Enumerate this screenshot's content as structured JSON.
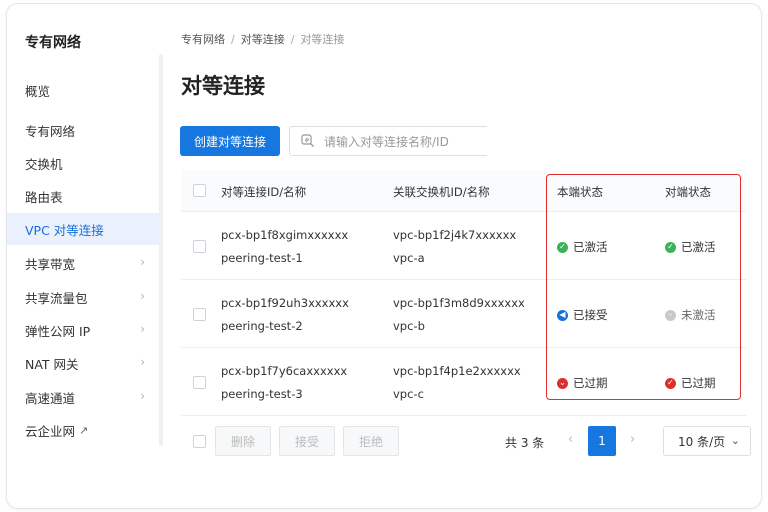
{
  "sidebar": {
    "title": "专有网络",
    "items": [
      {
        "label": "概览"
      },
      {
        "label": "专有网络"
      },
      {
        "label": "交换机"
      },
      {
        "label": "路由表"
      },
      {
        "label": "VPC 对等连接"
      },
      {
        "label": "共享带宽"
      },
      {
        "label": "共享流量包"
      },
      {
        "label": "弹性公网 IP"
      },
      {
        "label": "NAT 网关"
      },
      {
        "label": "高速通道"
      },
      {
        "label": "云企业网"
      }
    ]
  },
  "breadcrumb": [
    "专有网络",
    "对等连接",
    "对等连接"
  ],
  "page_title": "对等连接",
  "toolbar": {
    "create_label": "创建对等连接",
    "search_placeholder": "请输入对等连接名称/ID"
  },
  "table": {
    "headers": {
      "name": "对等连接ID/名称",
      "peer": "关联交换机ID/名称",
      "local_status": "本端状态",
      "remote_status": "对端状态"
    },
    "rows": [
      {
        "id": "pcx-bp1f8xgimxxxxxx",
        "name": "peering-test-1",
        "vpc_id": "vpc-bp1f2j4k7xxxxxx",
        "vpc_name": "vpc-a",
        "local_status": "已激活",
        "remote_status": "已激活"
      },
      {
        "id": "pcx-bp1f92uh3xxxxxx",
        "name": "peering-test-2",
        "vpc_id": "vpc-bp1f3m8d9xxxxxx",
        "vpc_name": "vpc-b",
        "local_status": "已接受",
        "remote_status": "未激活"
      },
      {
        "id": "pcx-bp1f7y6caxxxxxx",
        "name": "peering-test-3",
        "vpc_id": "vpc-bp1f4p1e2xxxxxx",
        "vpc_name": "vpc-c",
        "local_status": "已过期",
        "remote_status": "已过期"
      }
    ]
  },
  "footer": {
    "delete_label": "删除",
    "accept_label": "接受",
    "reject_label": "拒绝",
    "total_text": "共 3 条",
    "current_page": "1",
    "page_size": "10 条/页"
  },
  "colors": {
    "primary": "#1677e0",
    "active": "#3cb15a",
    "accepted": "#1a6fd9",
    "inactive": "#c6c9ce",
    "expired": "#d7322e",
    "highlight": "#e02e2e"
  }
}
